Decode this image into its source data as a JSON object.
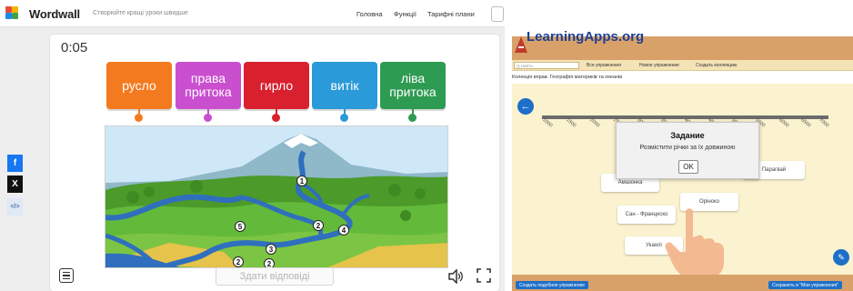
{
  "wordwall": {
    "logo_text": "Wordwall",
    "tagline": "Створюйте кращі уроки швидше",
    "nav": [
      "Головна",
      "Функції",
      "Тарифні плани"
    ],
    "timer": "0:05",
    "labels": [
      {
        "text": "русло",
        "color": "#f47a1f"
      },
      {
        "text": "права притока",
        "color": "#c94fcf"
      },
      {
        "text": "гирло",
        "color": "#d8202f"
      },
      {
        "text": "витік",
        "color": "#2a9ad8"
      },
      {
        "text": "ліва притока",
        "color": "#2e9b52"
      }
    ],
    "map_markers": [
      "1",
      "2",
      "3",
      "4",
      "5",
      "2",
      "2"
    ],
    "submit_label": "Здати відповіді",
    "share": [
      {
        "icon": "facebook-icon",
        "glyph": "f",
        "color": "#1877f2"
      },
      {
        "icon": "x-icon",
        "glyph": "X",
        "color": "#111111"
      },
      {
        "icon": "embed-icon",
        "glyph": "</>",
        "color": "#dfe8f5"
      }
    ]
  },
  "learningapps": {
    "logo_text": "LearningApps.org",
    "search_placeholder": "Q Найти",
    "toolbar": [
      "Все упражнения",
      "Новое упражнение",
      "Создать коллекцию"
    ],
    "breadcrumb": "Колекція вправ. Географія материків та океанів",
    "axis_ticks": [
      "1000",
      "1500",
      "2000",
      "2500",
      "3000",
      "3500",
      "4000",
      "4500",
      "5000",
      "5500",
      "6000",
      "6500",
      "7000"
    ],
    "cards": [
      "Амазонка",
      "Оріноко",
      "Сан - Франциско",
      "Укаялі",
      "Парагвай"
    ],
    "dialog": {
      "title": "Задание",
      "message": "Розмістити річки за їх довжиною",
      "ok": "OK"
    },
    "bottom_buttons": [
      "Создать подобное упражнение",
      "Сохранить в \"Мои упражнения\""
    ]
  }
}
